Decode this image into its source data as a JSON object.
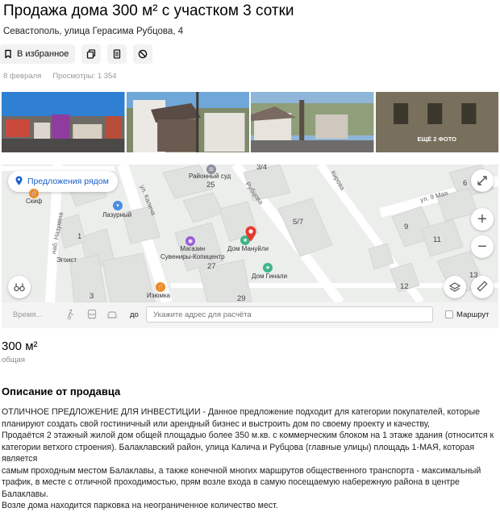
{
  "listing": {
    "title": "Продажа дома 300 м² с участком 3 сотки",
    "address": "Севастополь, улица Герасима Рубцова, 4",
    "favorite_label": "В избранное",
    "date": "8 февраля",
    "views": "Просмотры: 1 354"
  },
  "actions": [
    {
      "name": "bookmark-icon",
      "label": "В избранное"
    },
    {
      "name": "copy-icon"
    },
    {
      "name": "notes-icon"
    },
    {
      "name": "block-icon"
    }
  ],
  "photos": {
    "more_label": "ЕЩЁ 2 ФОТО"
  },
  "map": {
    "nearby_label": "Предложения рядом",
    "pois": {
      "court": "Районный суд",
      "skif": "Скиф",
      "lazurny": "Лазурный",
      "egoist": "Эгоист",
      "shop": "Магазин\nСувениры-Копицентр",
      "manuili": "Дом Мануйли",
      "ginali": "Дом Гинали",
      "izyuminka": "Изюмка"
    },
    "streets": {
      "kalicha": "ул. Калича",
      "rubtsova": "Рубцова",
      "kirova": "Кирова",
      "may9": "ул. 9 Мая",
      "nazukina": "наб. Назукина"
    },
    "numbers": [
      "25",
      "3/4",
      "5/7",
      "1",
      "27",
      "29",
      "3",
      "9",
      "11",
      "12",
      "6",
      "13"
    ],
    "icons": [
      "expand-icon",
      "zoom-in-icon",
      "zoom-out-icon",
      "layers-icon",
      "ruler-icon",
      "binoculars-icon"
    ]
  },
  "route": {
    "time_placeholder": "Время...",
    "to_label": "до",
    "address_placeholder": "Укажите адрес для расчёта",
    "route_label": "Маршрут"
  },
  "details": {
    "area": "300 м²",
    "area_caption": "общая"
  },
  "description": {
    "heading": "Описание от продавца",
    "lines": [
      "ОТЛИЧНОЕ ПРЕДЛОЖЕНИЕ ДЛЯ ИНВЕСТИЦИИ - Данное предложение подходит для категории покупателей, которые",
      "планируют создать свой гостиничный или арендный бизнес и выстроить дом по своему проекту и качеству,",
      "Продаётся 2 этажный жилой дом общей площадью более 350 м.кв. с коммерческим блоком на 1 этаже здания (относится к",
      "категории ветхого строения). Балаклавский район, улица Калича и Рубцова (главные улицы) площадь 1-МАЯ, которая является",
      "самым проходным местом Балаклавы, а также конечной многих маршрутов общественного транспорта - максимальный",
      "трафик, в месте с отличной проходимостью, прям возле входа в самую посещаемую набережную района в центре Балаклавы.",
      "Возле дома находится парковка на неограниченное количество мест."
    ]
  },
  "colors": {
    "link": "#1a5ecc",
    "pin": "#e63a2e",
    "poi_green": "#3fb58a",
    "poi_purple": "#9a5bd6",
    "poi_orange": "#f08a24",
    "poi_blue": "#4a8de0"
  }
}
